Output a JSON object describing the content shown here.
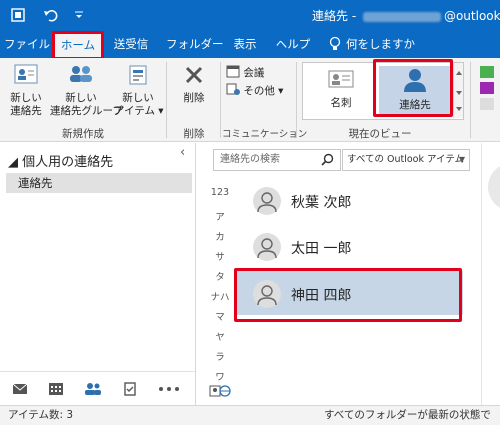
{
  "titlebar": {
    "title_prefix": "連絡先 - ",
    "title_suffix": "@outlook.j",
    "icons": [
      "outlook-app-icon",
      "undo-icon",
      "quick-access-dropdown-icon"
    ]
  },
  "menu": {
    "tabs": [
      {
        "label": "ファイル"
      },
      {
        "label": "ホーム",
        "active": true
      },
      {
        "label": "送受信"
      },
      {
        "label": "フォルダー"
      },
      {
        "label": "表示"
      },
      {
        "label": "ヘルプ"
      },
      {
        "label": "何をしますか",
        "icon": "lightbulb-icon"
      }
    ]
  },
  "ribbon": {
    "new_contact": "新しい\n連絡先",
    "new_group": "新しい\n連絡先グループ",
    "new_items": "新しい\nアイテム ▾",
    "group_new": "新規作成",
    "delete": "削除",
    "group_delete": "削除",
    "meeting": "会議",
    "more": "その他 ▾",
    "group_communication": "コミュニケーション",
    "view_card": "名刺",
    "view_people": "連絡先",
    "group_view": "現在のビュー"
  },
  "folder_pane": {
    "header": "◢ 個人用の連絡先",
    "item": "連絡先",
    "collapse": "‹",
    "nav_icons": [
      "mail-icon",
      "calendar-icon",
      "people-icon",
      "tasks-icon",
      "more-icon"
    ]
  },
  "list": {
    "search_placeholder": "連絡先の検索",
    "scope": "すべての Outlook アイテム",
    "index": [
      "123",
      "ア",
      "カ",
      "サ",
      "タ",
      "ナハ",
      "マ",
      "ヤ",
      "ラ",
      "ワ"
    ],
    "contacts": [
      {
        "name": "秋葉 次郎",
        "selected": false
      },
      {
        "name": "太田 一郎",
        "selected": false
      },
      {
        "name": "神田 四郎",
        "selected": true
      }
    ]
  },
  "status": {
    "items": "アイテム数: 3",
    "sync": "すべてのフォルダーが最新の状態です。"
  },
  "colors": {
    "accent": "#0b6ac3",
    "highlight": "#e3001b",
    "selection": "#c7d6e6"
  }
}
